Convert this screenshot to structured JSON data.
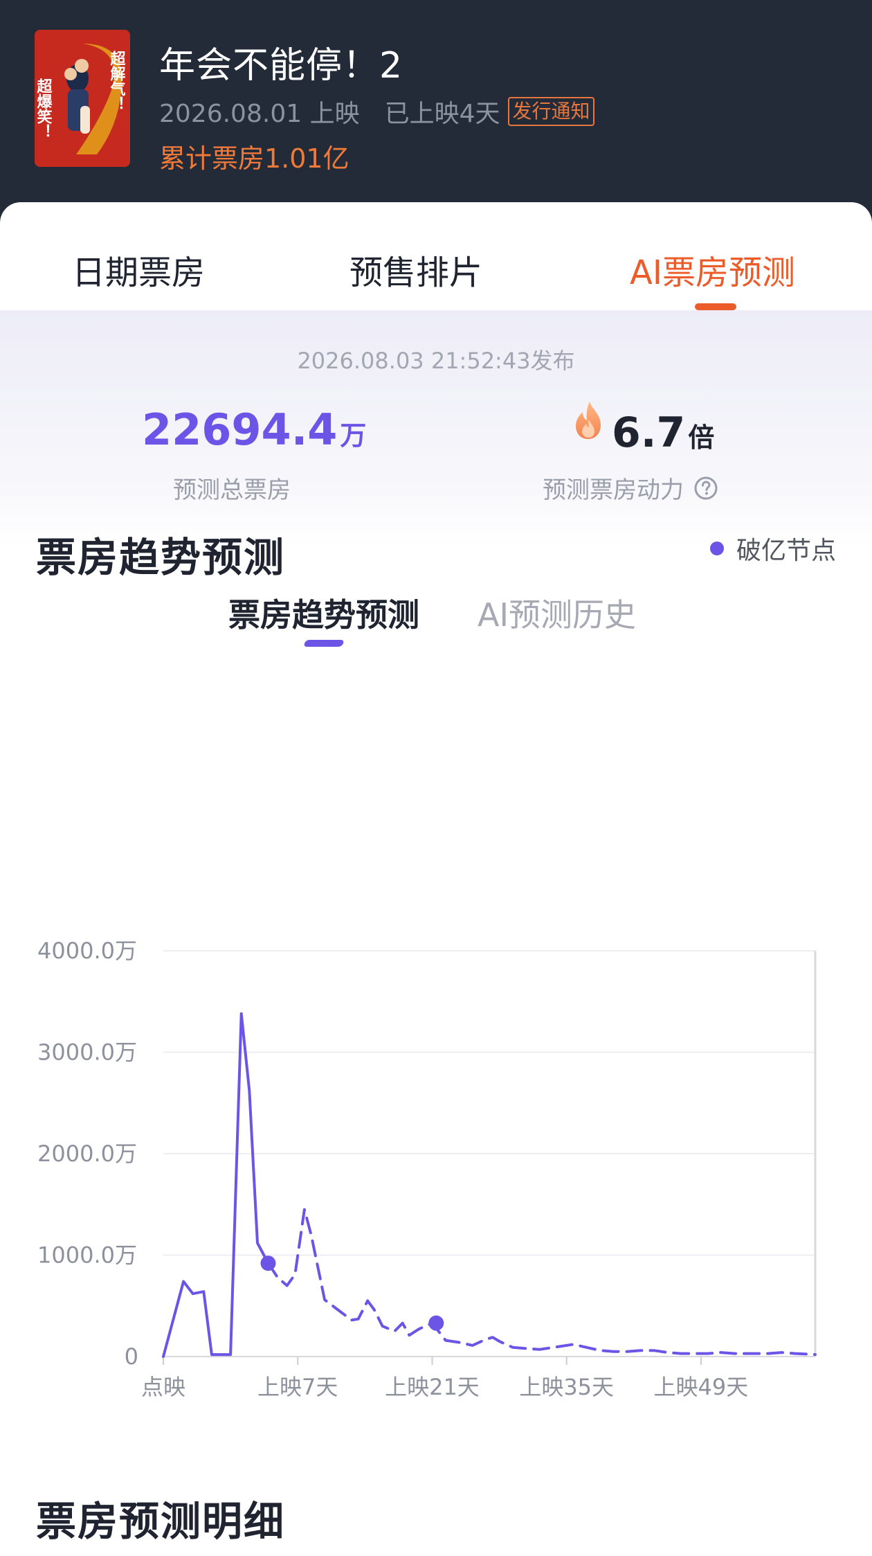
{
  "movie": {
    "title": "年会不能停！2",
    "release_text": "2026.08.01 上映",
    "days_text": "已上映4天",
    "notice_badge": "发行通知",
    "cumulative_box_office": "累计票房1.01亿",
    "poster_texts": [
      "超爆笑！",
      "超解气！"
    ]
  },
  "tabs": [
    {
      "label": "日期票房",
      "active": false
    },
    {
      "label": "预售排片",
      "active": false
    },
    {
      "label": "AI票房预测",
      "active": true
    }
  ],
  "forecast": {
    "publish_time": "2026.08.03 21:52:43发布",
    "total_value": "22694.4",
    "total_unit": "万",
    "total_label": "预测总票房",
    "multiplier_value": "6.7",
    "multiplier_unit": "倍",
    "multiplier_label": "预测票房动力"
  },
  "subtabs": [
    {
      "label": "票房趋势预测",
      "active": true
    },
    {
      "label": "AI预测历史",
      "active": false
    }
  ],
  "trend_section": {
    "title": "票房趋势预测",
    "legend_label": "破亿节点"
  },
  "detail_section": {
    "title": "票房预测明细"
  },
  "colors": {
    "accent_purple": "#6c55e6",
    "accent_orange": "#ec5b2a",
    "header_bg": "#232b38"
  },
  "chart_data": {
    "type": "line",
    "ylim": [
      0,
      4000
    ],
    "y_ticks": [
      0,
      1000,
      2000,
      3000,
      4000
    ],
    "y_tick_labels": [
      "0",
      "1000.0万",
      "2000.0万",
      "3000.0万",
      "4000.0万"
    ],
    "x_tick_labels": [
      {
        "x": 0,
        "label": "点映"
      },
      {
        "x": 10,
        "label": "上映7天"
      },
      {
        "x": 20,
        "label": "上映21天"
      },
      {
        "x": 30,
        "label": "上映35天"
      },
      {
        "x": 40,
        "label": "上映49天"
      }
    ],
    "xlim": [
      0,
      48.5
    ],
    "series": [
      {
        "style": "solid",
        "points": [
          [
            0,
            0
          ],
          [
            1.5,
            740
          ],
          [
            2.2,
            620
          ],
          [
            3,
            640
          ],
          [
            3.6,
            20
          ],
          [
            4,
            20
          ],
          [
            5,
            20
          ],
          [
            5.8,
            3380
          ],
          [
            6.4,
            2620
          ],
          [
            7,
            1120
          ],
          [
            7.8,
            920
          ]
        ]
      },
      {
        "style": "dashed",
        "points": [
          [
            7.8,
            920
          ],
          [
            8.5,
            780
          ],
          [
            9.2,
            700
          ],
          [
            9.8,
            810
          ],
          [
            10.5,
            1450
          ],
          [
            11,
            1200
          ],
          [
            12,
            560
          ],
          [
            13,
            460
          ],
          [
            14,
            360
          ],
          [
            14.5,
            370
          ],
          [
            15.2,
            550
          ],
          [
            15.7,
            460
          ],
          [
            16.3,
            300
          ],
          [
            17.2,
            250
          ],
          [
            17.8,
            330
          ],
          [
            18.3,
            210
          ],
          [
            19,
            270
          ],
          [
            20,
            330
          ],
          [
            21,
            160
          ],
          [
            22,
            140
          ],
          [
            23,
            110
          ],
          [
            24,
            170
          ],
          [
            24.5,
            190
          ],
          [
            25,
            150
          ],
          [
            26,
            90
          ],
          [
            27,
            80
          ],
          [
            28,
            70
          ],
          [
            29,
            90
          ],
          [
            30.5,
            120
          ],
          [
            31.5,
            90
          ],
          [
            32.5,
            60
          ],
          [
            33.5,
            50
          ],
          [
            34.5,
            50
          ],
          [
            35.5,
            60
          ],
          [
            36.5,
            60
          ],
          [
            37.5,
            40
          ],
          [
            38.5,
            30
          ],
          [
            39.5,
            30
          ],
          [
            40.5,
            30
          ],
          [
            41.5,
            40
          ],
          [
            42.5,
            30
          ],
          [
            44,
            30
          ],
          [
            45,
            30
          ],
          [
            46,
            40
          ],
          [
            47,
            30
          ],
          [
            48.5,
            20
          ]
        ]
      }
    ],
    "milestones": [
      [
        7.8,
        920
      ],
      [
        20.3,
        330
      ]
    ]
  }
}
